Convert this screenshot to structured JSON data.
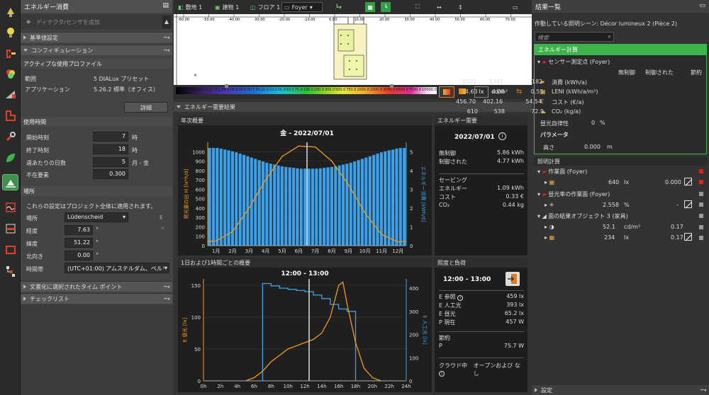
{
  "left_panel": {
    "title": "エネルギー消費",
    "add_sensor": "ディテクタ/センサを追加",
    "sections": {
      "basic": "基準値設定",
      "config": "コンフィギュレーション",
      "doc": "文書化に選択されたタイム ポイント",
      "checklist": "チェックリスト"
    },
    "active_profile_title": "アクティブな使用プロファイル",
    "range_label": "範囲",
    "range_value": "5 DIALux プリセット",
    "app_label": "アプリケーション",
    "app_value": "5.26.2 標準（オフィス）",
    "detail_btn": "詳細",
    "usage_title": "使用時間",
    "start_label": "開始時刻",
    "start_value": "7",
    "hour_unit": "時",
    "end_label": "終了時刻",
    "end_value": "18",
    "days_label": "週あたりの日数",
    "days_value": "5",
    "days_unit": "月 - 金",
    "absence_label": "不在要素",
    "absence_value": "0.300",
    "location_title": "場所",
    "location_note": "これらの設定はプロジェクト全体に適用されます。",
    "place_label": "場所",
    "place_value": "Lüdenscheid",
    "lon_label": "経度",
    "lon_value": "7.63",
    "lat_label": "緯度",
    "lat_value": "51.22",
    "north_label": "北向き",
    "north_value": "0.00",
    "deg": "°",
    "tz_label": "時間帯",
    "tz_value": "(UTC+01:00) アムステルダム、ベルリン、ベ"
  },
  "toolbar": {
    "site": "敷地 1",
    "building": "建物 1",
    "floor": "フロア 1",
    "room": "Foyer"
  },
  "scale": {
    "ticks": [
      "-60.00",
      "-50.00",
      "-40.00",
      "-30.00",
      "-20.00",
      "-10.00",
      "0.00",
      "10.00",
      "20.00",
      "30.00",
      "40.00",
      "50.00",
      "60.00",
      "70.00"
    ]
  },
  "colorbar": {
    "values": [
      "0.10",
      "0.20",
      "0.30",
      "0.50",
      "0.75",
      "1.00",
      "2.00",
      "3.00",
      "5.00",
      "7.50",
      "10.0",
      "20.0",
      "30.0",
      "50.0",
      "75.0",
      "100.0",
      "200.0",
      "300.0",
      "500.0",
      "750.0",
      "1000.0",
      "2000.0",
      "3000.0",
      "5000.0",
      "7500.0",
      "10000.0"
    ],
    "unit_lx": "lx",
    "unit_cd": "cd/m²"
  },
  "energy_results_title": "エネルギー需要結果",
  "annual_card": {
    "title": "年次概要",
    "chart_title": "金 - 2022/07/01"
  },
  "daily_card": {
    "title": "1日および1時間ごとの概要",
    "chart_title": "12:00 - 13:00"
  },
  "energy_demand": {
    "title": "エネルギー需要",
    "date": "2022/07/01",
    "rows": [
      [
        "無制御",
        "5.86 kWh"
      ],
      [
        "制御された",
        "4.77 kWh"
      ]
    ],
    "saving_title": "セービング",
    "saving_rows": [
      [
        "エネルギー",
        "1.09 kWh"
      ],
      [
        "コスト",
        "0.33 €"
      ],
      [
        "CO₂",
        "0.44 kg"
      ]
    ]
  },
  "illum_load": {
    "title": "照度と負荷",
    "time": "12:00 - 13:00",
    "rows": [
      [
        "E 参照",
        "459 lx"
      ],
      [
        "E 人工光",
        "393 lx"
      ],
      [
        "E 昼光",
        "65.2 lx"
      ],
      [
        "P 現在",
        "457 W"
      ]
    ],
    "saving_title": "節約",
    "saving_rows": [
      [
        "P",
        "75.7 W"
      ]
    ],
    "cloud_label": "クラウド中",
    "cloud_value": "オープンおよび なし"
  },
  "right_panel": {
    "title": "結果一覧",
    "scene_label": "作動している照明シーン: Décor lumineux 2 (Pièce 2)",
    "search_placeholder": "検索",
    "energy_calc_title": "エネルギー計算",
    "sensor_label": "センサー測定点 (Foyer)",
    "cols": [
      "無制御",
      "制御された",
      "節約"
    ],
    "rows": [
      {
        "label": "消費 (kWh/a)",
        "v": [
          "1522",
          "1341",
          "182"
        ]
      },
      {
        "label": "LENI (kWh/a/m²)",
        "v": [
          "4.63",
          "4.08",
          "0.55"
        ]
      },
      {
        "label": "コスト (€/a)",
        "v": [
          "456.70",
          "402.16",
          "54.54"
        ]
      },
      {
        "label": "CO₂ (kg/a)",
        "v": [
          "610",
          "538",
          "72.9"
        ]
      }
    ],
    "daylight_label": "昼光自律性",
    "daylight_value": "0",
    "pct": "%",
    "params_title": "パラメータ",
    "height_label": "高さ",
    "height_value": "0.000",
    "m": "m",
    "lighting_title": "照明計算",
    "work_plane": "作業面 (Foyer)",
    "work_value": "640",
    "work_unit": "lx",
    "work_value2": "0.000",
    "daylight_plane": "昼光率の作業面 (Foyer)",
    "daylight_factor": "2.558",
    "daylight_unit": "%",
    "dash": "-",
    "surface_title": "面の結果オブジェクト 3 (家具)",
    "surface_rows": [
      [
        "52.1",
        "cd/m²",
        "0.17"
      ],
      [
        "234",
        "lx",
        "0.17"
      ]
    ],
    "settings": "設定"
  },
  "colors": {
    "accent_green": "#3cb44b",
    "chart_orange": "#f29a1f",
    "chart_blue": "#3ea0e6",
    "error_red": "#e02020"
  },
  "chart_data": [
    {
      "type": "bar",
      "title": "金 - 2022/07/01",
      "x": [
        "1月",
        "2月",
        "3月",
        "4月",
        "5月",
        "6月",
        "7月",
        "8月",
        "9月",
        "10月",
        "11月",
        "12月"
      ],
      "xlabel": "",
      "ylabel": "発光量の出 H [lx*h/d]",
      "y2label": "エネルギー消費 [kWh/d]",
      "ylim": [
        0,
        1100
      ],
      "y2lim": [
        0,
        5.5
      ],
      "series": [
        {
          "name": "エネルギー消費 [kWh/d]",
          "axis": "right",
          "values": [
            5.2,
            5.0,
            4.7,
            4.4,
            4.2,
            4.1,
            4.1,
            4.2,
            4.4,
            4.7,
            5.0,
            5.2
          ]
        },
        {
          "name": "発光量の出 H [lx*h/d]",
          "axis": "left",
          "values": [
            50,
            150,
            400,
            700,
            950,
            1060,
            1050,
            900,
            650,
            350,
            120,
            40
          ]
        }
      ],
      "yticks": [
        0,
        100,
        200,
        300,
        400,
        500,
        600,
        700,
        800,
        900,
        1000
      ],
      "y2ticks": [
        0,
        1,
        2,
        3,
        4,
        5
      ]
    },
    {
      "type": "line",
      "title": "12:00 - 13:00",
      "x": [
        "0h",
        "2h",
        "4h",
        "6h",
        "8h",
        "10h",
        "12h",
        "14h",
        "16h",
        "18h",
        "20h",
        "22h",
        "24h"
      ],
      "ylabel": "E 昼光 [lx]",
      "y2label": "E 人工光 [lx]",
      "ylim": [
        0,
        160
      ],
      "y2lim": [
        0,
        440
      ],
      "series": [
        {
          "name": "E 昼光 [lx]",
          "axis": "left",
          "values": [
            [
              5,
              0
            ],
            [
              6,
              5
            ],
            [
              7,
              15
            ],
            [
              8,
              30
            ],
            [
              9,
              40
            ],
            [
              10,
              50
            ],
            [
              11,
              55
            ],
            [
              12,
              60
            ],
            [
              13,
              65
            ],
            [
              14,
              75
            ],
            [
              15,
              100
            ],
            [
              16,
              150
            ],
            [
              16.5,
              155
            ],
            [
              17,
              120
            ],
            [
              18,
              60
            ],
            [
              19,
              20
            ],
            [
              20,
              5
            ],
            [
              21,
              0
            ]
          ]
        },
        {
          "name": "E 人工光 [lx]",
          "axis": "right",
          "values": [
            [
              7,
              420
            ],
            [
              8,
              410
            ],
            [
              9,
              400
            ],
            [
              10,
              395
            ],
            [
              11,
              390
            ],
            [
              12,
              385
            ],
            [
              13,
              370
            ],
            [
              14,
              355
            ],
            [
              15,
              330
            ],
            [
              16,
              310
            ],
            [
              17,
              300
            ],
            [
              18,
              0
            ]
          ]
        }
      ],
      "yticks": [
        0,
        50,
        100,
        150
      ],
      "y2ticks": [
        0,
        100,
        200,
        300,
        400
      ],
      "marker_hour": 12
    }
  ]
}
